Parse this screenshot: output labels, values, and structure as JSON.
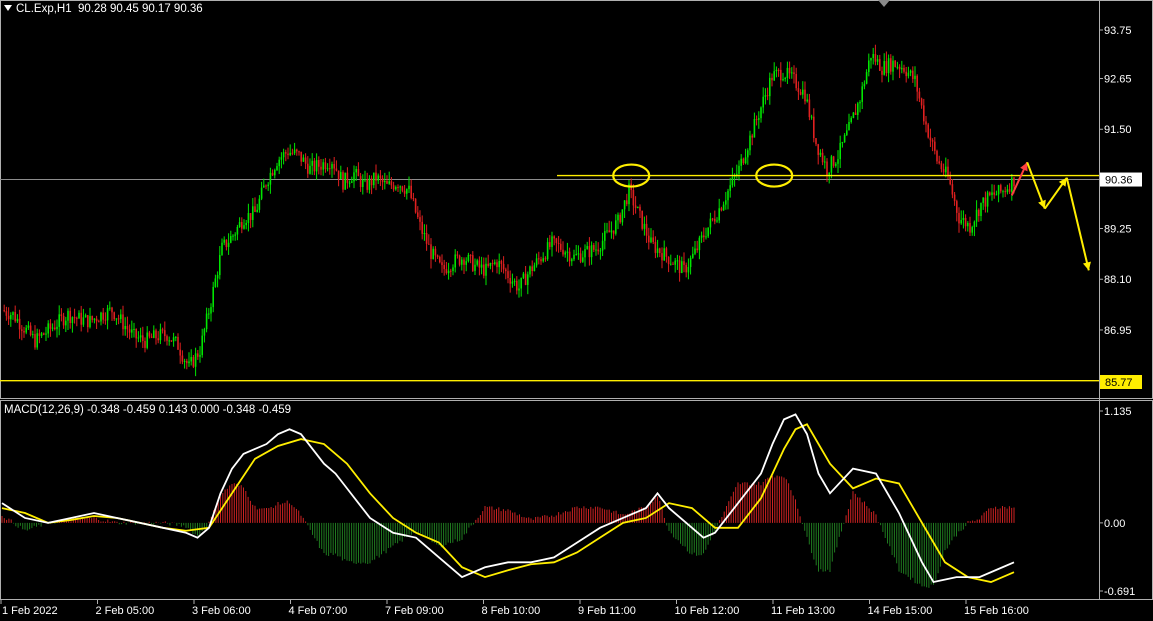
{
  "header": {
    "symbol": "CL.Exp,H1",
    "ohlc": "90.28 90.45 90.17 90.36",
    "menu_icon": "triangle-down-icon"
  },
  "price_badges": {
    "current": "90.36",
    "support": "85.77"
  },
  "macd": {
    "label": "MACD(12,26,9) -0.348 -0.459 0.143 0.000 -0.348 -0.459"
  },
  "colors": {
    "background": "#000000",
    "candle_up": "#00e600",
    "candle_down": "#e02020",
    "macd_line": "#ffffff",
    "signal_line": "#ffee00",
    "hist_up": "#cc2222",
    "hist_down": "#1f7a1f",
    "annotation": "#ffee00",
    "grid_border": "#b0b0b0"
  },
  "chart_data": [
    {
      "type": "candlestick",
      "title": "",
      "ylim": [
        85.2,
        94.3
      ],
      "y_ticks": [
        "93.75",
        "92.65",
        "91.50",
        "90.36",
        "89.25",
        "88.10",
        "86.95",
        "85.77"
      ],
      "x_ticks": [
        "1 Feb 2022",
        "2 Feb 05:00",
        "3 Feb 06:00",
        "4 Feb 07:00",
        "7 Feb 09:00",
        "8 Feb 10:00",
        "9 Feb 11:00",
        "10 Feb 12:00",
        "11 Feb 13:00",
        "14 Feb 15:00",
        "15 Feb 16:00"
      ],
      "close_path": [
        [
          0,
          87.4
        ],
        [
          5,
          87.3
        ],
        [
          10,
          87.0
        ],
        [
          15,
          86.7
        ],
        [
          20,
          86.9
        ],
        [
          25,
          87.1
        ],
        [
          30,
          87.3
        ],
        [
          35,
          87.2
        ],
        [
          40,
          87.15
        ],
        [
          45,
          87.3
        ],
        [
          50,
          87.4
        ],
        [
          55,
          87.1
        ],
        [
          60,
          86.8
        ],
        [
          65,
          86.7
        ],
        [
          70,
          86.8
        ],
        [
          75,
          86.85
        ],
        [
          80,
          86.6
        ],
        [
          85,
          86.1
        ],
        [
          90,
          86.5
        ],
        [
          95,
          87.6
        ],
        [
          100,
          88.8
        ],
        [
          105,
          89.1
        ],
        [
          110,
          89.5
        ],
        [
          115,
          89.6
        ],
        [
          120,
          90.3
        ],
        [
          125,
          90.8
        ],
        [
          130,
          91.0
        ],
        [
          135,
          90.9
        ],
        [
          140,
          90.6
        ],
        [
          145,
          90.7
        ],
        [
          150,
          90.8
        ],
        [
          155,
          90.3
        ],
        [
          160,
          90.5
        ],
        [
          165,
          90.2
        ],
        [
          170,
          90.4
        ],
        [
          175,
          90.2
        ],
        [
          180,
          90.3
        ],
        [
          185,
          90.1
        ],
        [
          190,
          89.3
        ],
        [
          195,
          88.7
        ],
        [
          200,
          88.3
        ],
        [
          205,
          88.5
        ],
        [
          210,
          88.6
        ],
        [
          215,
          88.4
        ],
        [
          220,
          88.3
        ],
        [
          225,
          88.5
        ],
        [
          230,
          88.2
        ],
        [
          235,
          87.9
        ],
        [
          240,
          88.3
        ],
        [
          245,
          88.6
        ],
        [
          250,
          88.9
        ],
        [
          255,
          88.8
        ],
        [
          260,
          88.6
        ],
        [
          265,
          88.7
        ],
        [
          270,
          88.8
        ],
        [
          275,
          89.1
        ],
        [
          280,
          89.4
        ],
        [
          285,
          90.1
        ],
        [
          290,
          89.5
        ],
        [
          295,
          88.9
        ],
        [
          300,
          88.7
        ],
        [
          305,
          88.5
        ],
        [
          310,
          88.3
        ],
        [
          315,
          88.7
        ],
        [
          320,
          89.2
        ],
        [
          325,
          89.6
        ],
        [
          330,
          90.1
        ],
        [
          335,
          90.6
        ],
        [
          340,
          91.3
        ],
        [
          345,
          92.0
        ],
        [
          350,
          92.7
        ],
        [
          355,
          92.8
        ],
        [
          360,
          92.6
        ],
        [
          365,
          92.3
        ],
        [
          370,
          91.2
        ],
        [
          375,
          90.6
        ],
        [
          380,
          90.9
        ],
        [
          385,
          91.5
        ],
        [
          390,
          92.2
        ],
        [
          395,
          93.2
        ],
        [
          400,
          92.9
        ],
        [
          405,
          93.0
        ],
        [
          410,
          92.9
        ],
        [
          415,
          92.6
        ],
        [
          420,
          91.6
        ],
        [
          425,
          90.8
        ],
        [
          430,
          90.4
        ],
        [
          435,
          89.5
        ],
        [
          440,
          89.3
        ],
        [
          445,
          89.8
        ],
        [
          450,
          90.0
        ],
        [
          455,
          90.1
        ],
        [
          460,
          90.36
        ]
      ],
      "yellow_levels": [
        90.45,
        85.8
      ],
      "highlighted_points": [
        [
          286,
          90.45
        ],
        [
          351,
          90.45
        ]
      ],
      "projection_path": [
        [
          459,
          90.0
        ],
        [
          466,
          90.75
        ],
        [
          474,
          89.7
        ],
        [
          484,
          90.4
        ],
        [
          494,
          88.3
        ]
      ]
    },
    {
      "type": "line",
      "title": "",
      "ylim": [
        -0.691,
        1.135
      ],
      "y_ticks": [
        "1.135",
        "0.00",
        "-0.691"
      ],
      "series": [
        {
          "name": "macd",
          "values": [
            [
              0,
              0.2
            ],
            [
              10,
              0.05
            ],
            [
              20,
              0.0
            ],
            [
              30,
              0.05
            ],
            [
              40,
              0.1
            ],
            [
              50,
              0.05
            ],
            [
              60,
              0.0
            ],
            [
              70,
              -0.05
            ],
            [
              80,
              -0.1
            ],
            [
              85,
              -0.15
            ],
            [
              90,
              -0.05
            ],
            [
              95,
              0.3
            ],
            [
              100,
              0.55
            ],
            [
              105,
              0.7
            ],
            [
              110,
              0.75
            ],
            [
              115,
              0.8
            ],
            [
              120,
              0.9
            ],
            [
              125,
              0.95
            ],
            [
              130,
              0.9
            ],
            [
              135,
              0.75
            ],
            [
              140,
              0.6
            ],
            [
              145,
              0.5
            ],
            [
              150,
              0.35
            ],
            [
              155,
              0.2
            ],
            [
              160,
              0.05
            ],
            [
              170,
              -0.1
            ],
            [
              180,
              -0.15
            ],
            [
              190,
              -0.35
            ],
            [
              200,
              -0.55
            ],
            [
              205,
              -0.5
            ],
            [
              210,
              -0.45
            ],
            [
              220,
              -0.4
            ],
            [
              230,
              -0.4
            ],
            [
              240,
              -0.35
            ],
            [
              250,
              -0.2
            ],
            [
              260,
              -0.05
            ],
            [
              270,
              0.05
            ],
            [
              280,
              0.15
            ],
            [
              285,
              0.3
            ],
            [
              290,
              0.15
            ],
            [
              300,
              -0.05
            ],
            [
              305,
              -0.15
            ],
            [
              310,
              -0.1
            ],
            [
              320,
              0.2
            ],
            [
              330,
              0.5
            ],
            [
              335,
              0.8
            ],
            [
              340,
              1.05
            ],
            [
              345,
              1.1
            ],
            [
              350,
              0.9
            ],
            [
              355,
              0.5
            ],
            [
              360,
              0.3
            ],
            [
              370,
              0.55
            ],
            [
              380,
              0.5
            ],
            [
              390,
              0.1
            ],
            [
              400,
              -0.4
            ],
            [
              405,
              -0.6
            ],
            [
              415,
              -0.55
            ],
            [
              425,
              -0.55
            ],
            [
              435,
              -0.45
            ],
            [
              440,
              -0.4
            ]
          ]
        },
        {
          "name": "signal",
          "values": [
            [
              0,
              0.15
            ],
            [
              10,
              0.1
            ],
            [
              20,
              0.0
            ],
            [
              30,
              0.03
            ],
            [
              40,
              0.07
            ],
            [
              50,
              0.05
            ],
            [
              60,
              0.0
            ],
            [
              70,
              -0.05
            ],
            [
              80,
              -0.08
            ],
            [
              90,
              -0.05
            ],
            [
              100,
              0.3
            ],
            [
              110,
              0.65
            ],
            [
              120,
              0.78
            ],
            [
              130,
              0.85
            ],
            [
              140,
              0.8
            ],
            [
              150,
              0.6
            ],
            [
              160,
              0.3
            ],
            [
              170,
              0.05
            ],
            [
              180,
              -0.1
            ],
            [
              190,
              -0.2
            ],
            [
              200,
              -0.45
            ],
            [
              210,
              -0.55
            ],
            [
              220,
              -0.48
            ],
            [
              230,
              -0.42
            ],
            [
              240,
              -0.4
            ],
            [
              250,
              -0.3
            ],
            [
              260,
              -0.15
            ],
            [
              270,
              0.0
            ],
            [
              280,
              0.05
            ],
            [
              290,
              0.2
            ],
            [
              300,
              0.15
            ],
            [
              310,
              -0.05
            ],
            [
              320,
              -0.05
            ],
            [
              330,
              0.25
            ],
            [
              340,
              0.75
            ],
            [
              345,
              0.95
            ],
            [
              350,
              1.0
            ],
            [
              360,
              0.6
            ],
            [
              370,
              0.35
            ],
            [
              380,
              0.45
            ],
            [
              390,
              0.4
            ],
            [
              400,
              0.0
            ],
            [
              410,
              -0.4
            ],
            [
              420,
              -0.55
            ],
            [
              430,
              -0.6
            ],
            [
              440,
              -0.5
            ]
          ]
        }
      ]
    }
  ]
}
